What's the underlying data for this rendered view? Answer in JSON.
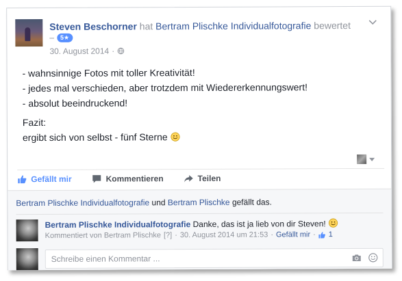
{
  "header": {
    "author": "Steven Beschorner",
    "verb_has": "hat",
    "page": "Bertram Plischke Individualfotografie",
    "verb_rated": "bewertet",
    "dash": "–",
    "rating_badge": "5★",
    "date": "30. August 2014",
    "meta_separator": "·"
  },
  "post": {
    "lines": [
      "- wahnsinnige Fotos mit toller Kreativität!",
      "- jedes mal verschieden, aber trotzdem mit Wiedererkennungswert!",
      "- absolut beeindruckend!"
    ],
    "fazit_label": "Fazit:",
    "fazit_text": "ergibt sich von selbst - fünf Sterne"
  },
  "actions": {
    "like": "Gefällt mir",
    "comment": "Kommentieren",
    "share": "Teilen"
  },
  "likes": {
    "person1": "Bertram Plischke Individualfotografie",
    "and": "und",
    "person2": "Bertram Plischke",
    "suffix": "gefällt das."
  },
  "comment": {
    "author": "Bertram Plischke Individualfotografie",
    "text": "Danke, das ist ja lieb von dir Steven!",
    "commented_by": "Kommentiert von Bertram Plischke",
    "help": "[?]",
    "dot": "·",
    "timestamp": "30. August 2014 um 21:53",
    "like_link": "Gefällt mir",
    "like_count": "1"
  },
  "reply": {
    "placeholder": "Schreibe einen Kommentar ..."
  },
  "colors": {
    "link": "#365899",
    "accent": "#5890ff",
    "muted": "#90949c"
  }
}
